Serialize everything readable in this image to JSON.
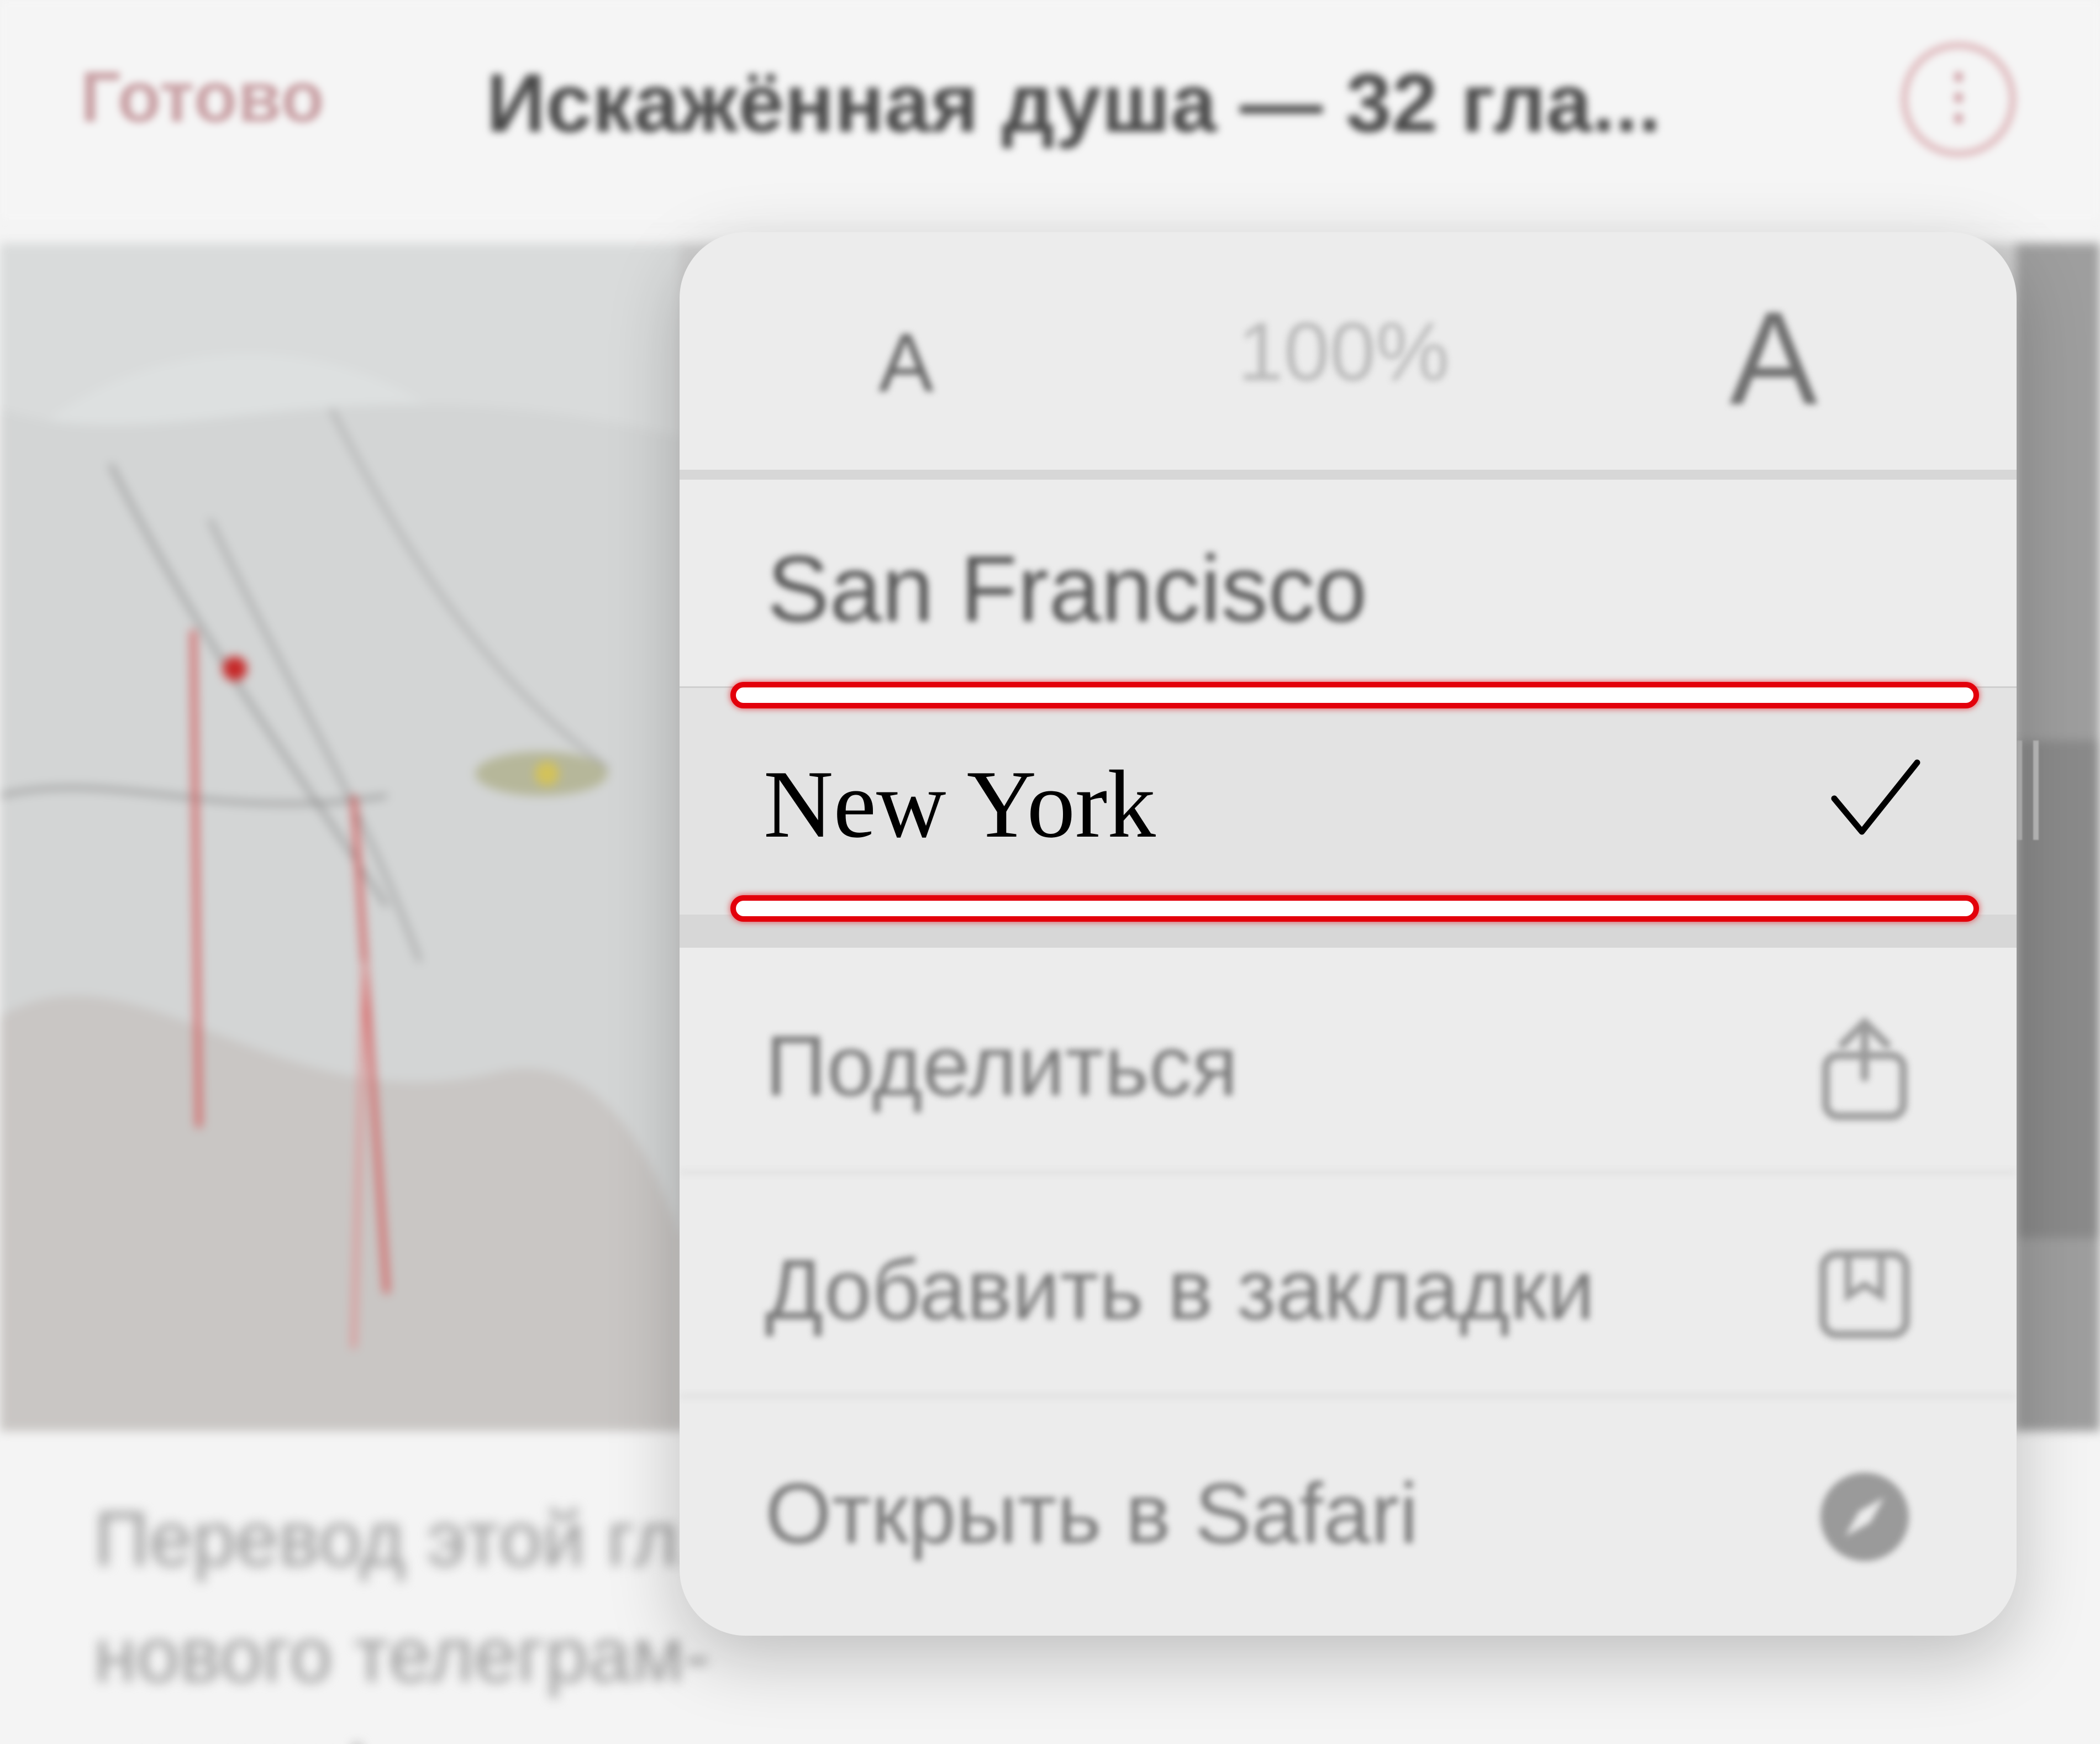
{
  "navbar": {
    "done_label": "Готово",
    "title": "Искажённая душа — 32 гла...",
    "more_label": "⋮"
  },
  "article": {
    "text": "Перевод этой гл... нового телеграм-канала!"
  },
  "menu": {
    "font_size": {
      "decrease_label": "A",
      "zoom_level": "100%",
      "increase_label": "A"
    },
    "fonts": [
      {
        "label": "San Francisco",
        "selected": false
      },
      {
        "label": "New York",
        "selected": true
      }
    ],
    "actions": [
      {
        "label": "Поделиться",
        "icon": "share-icon"
      },
      {
        "label": "Добавить в закладки",
        "icon": "bookmark-icon"
      },
      {
        "label": "Открыть в Safari",
        "icon": "compass-icon"
      }
    ]
  },
  "colors": {
    "accent": "#d32f3a",
    "annotation": "#e3000b",
    "menu_bg": "#ececec",
    "selected_row_bg": "#e3e3e3"
  }
}
